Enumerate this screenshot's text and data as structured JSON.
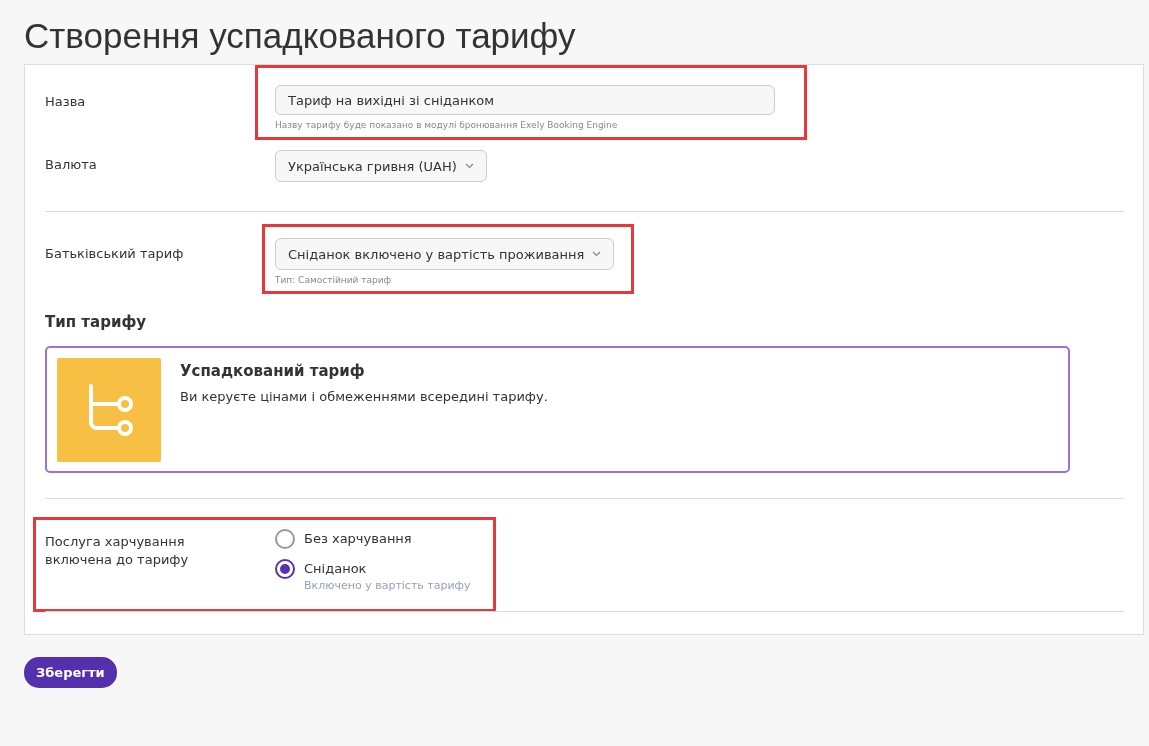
{
  "page_title": "Створення успадкованого тарифу",
  "name_field": {
    "label": "Назва",
    "value": "Тариф на вихідні зі сніданком",
    "hint": "Назву тарифу буде показано в модулі бронювання Exely Booking Engine",
    "highlighted": true
  },
  "currency_field": {
    "label": "Валюта",
    "value": "Українська гривня (UAH)",
    "highlighted": false
  },
  "parent_tariff_field": {
    "label": "Батьківський тариф",
    "value": "Сніданок включено у вартість проживання",
    "hint": "Тип: Самостійний тариф",
    "highlighted": true
  },
  "tariff_type": {
    "heading": "Тип тарифу",
    "options": [
      {
        "title": "Успадкований тариф",
        "description": "Ви керуєте цінами і обмеженнями всередині тарифу.",
        "selected": true
      }
    ]
  },
  "meal_service": {
    "label": "Послуга харчування включена до тарифу",
    "highlighted": true,
    "options": [
      {
        "label": "Без харчування",
        "selected": false
      },
      {
        "label": "Сніданок",
        "note": "Включено у вартість тарифу",
        "selected": true
      }
    ]
  },
  "save_button": "Зберегти"
}
